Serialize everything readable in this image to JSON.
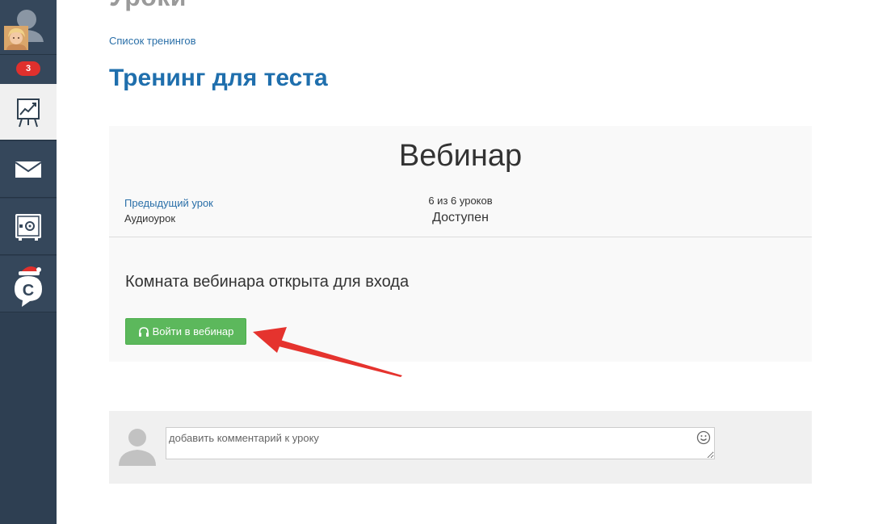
{
  "sidebar": {
    "notification_count": "3",
    "items": [
      {
        "name": "training-icon"
      },
      {
        "name": "mail-icon"
      },
      {
        "name": "safe-icon"
      },
      {
        "name": "chat-c-icon"
      }
    ]
  },
  "header": {
    "page_heading": "Уроки",
    "breadcrumb": "Список тренингов",
    "training_title": "Тренинг для теста"
  },
  "lesson": {
    "title": "Вебинар",
    "prev_link": "Предыдущий урок",
    "prev_name": "Аудиоурок",
    "progress": "6 из 6 уроков",
    "status": "Доступен",
    "room_text": "Комната вебинара открыта для входа",
    "join_button": "Войти в вебинар"
  },
  "comment": {
    "placeholder": "добавить комментарий к уроку"
  },
  "colors": {
    "accent": "#1f6fad",
    "button": "#5cb85c",
    "arrow": "#e5332e",
    "badge": "#e0302d"
  }
}
